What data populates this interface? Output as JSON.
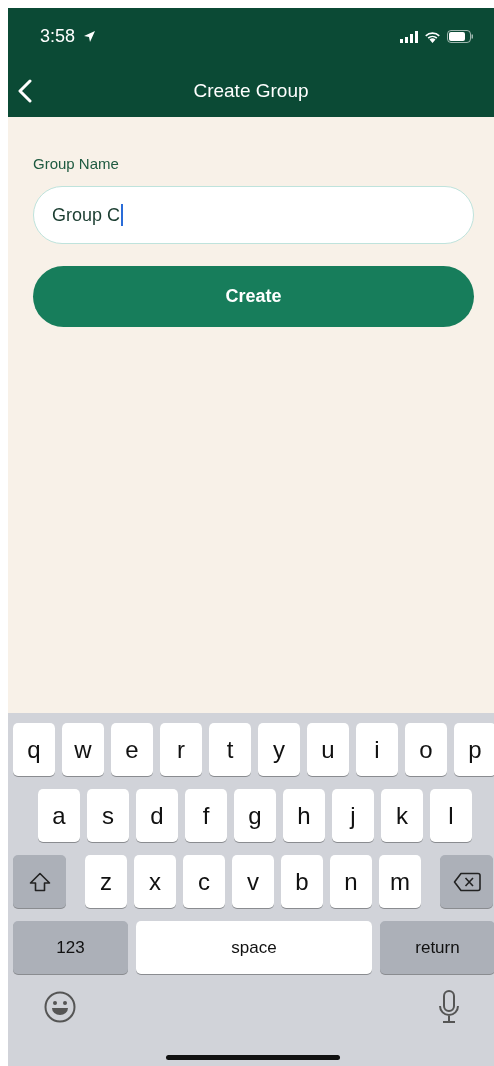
{
  "status_bar": {
    "time": "3:58"
  },
  "nav": {
    "title": "Create Group"
  },
  "form": {
    "label": "Group Name",
    "value": "Group C",
    "focused": true,
    "button": "Create"
  },
  "keyboard": {
    "rows": [
      [
        {
          "kind": "letter",
          "label": "q"
        },
        {
          "kind": "letter",
          "label": "w"
        },
        {
          "kind": "letter",
          "label": "e"
        },
        {
          "kind": "letter",
          "label": "r"
        },
        {
          "kind": "letter",
          "label": "t"
        },
        {
          "kind": "letter",
          "label": "y"
        },
        {
          "kind": "letter",
          "label": "u"
        },
        {
          "kind": "letter",
          "label": "i"
        },
        {
          "kind": "letter",
          "label": "o"
        },
        {
          "kind": "letter",
          "label": "p"
        }
      ],
      [
        {
          "kind": "letter",
          "label": "a"
        },
        {
          "kind": "letter",
          "label": "s"
        },
        {
          "kind": "letter",
          "label": "d"
        },
        {
          "kind": "letter",
          "label": "f"
        },
        {
          "kind": "letter",
          "label": "g"
        },
        {
          "kind": "letter",
          "label": "h"
        },
        {
          "kind": "letter",
          "label": "j"
        },
        {
          "kind": "letter",
          "label": "k"
        },
        {
          "kind": "letter",
          "label": "l"
        }
      ],
      [
        {
          "kind": "shift"
        },
        {
          "kind": "letter",
          "label": "z"
        },
        {
          "kind": "letter",
          "label": "x"
        },
        {
          "kind": "letter",
          "label": "c"
        },
        {
          "kind": "letter",
          "label": "v"
        },
        {
          "kind": "letter",
          "label": "b"
        },
        {
          "kind": "letter",
          "label": "n"
        },
        {
          "kind": "letter",
          "label": "m"
        },
        {
          "kind": "delete"
        }
      ]
    ],
    "numbers_key": "123",
    "space_key": "space",
    "return_key": "return"
  }
}
